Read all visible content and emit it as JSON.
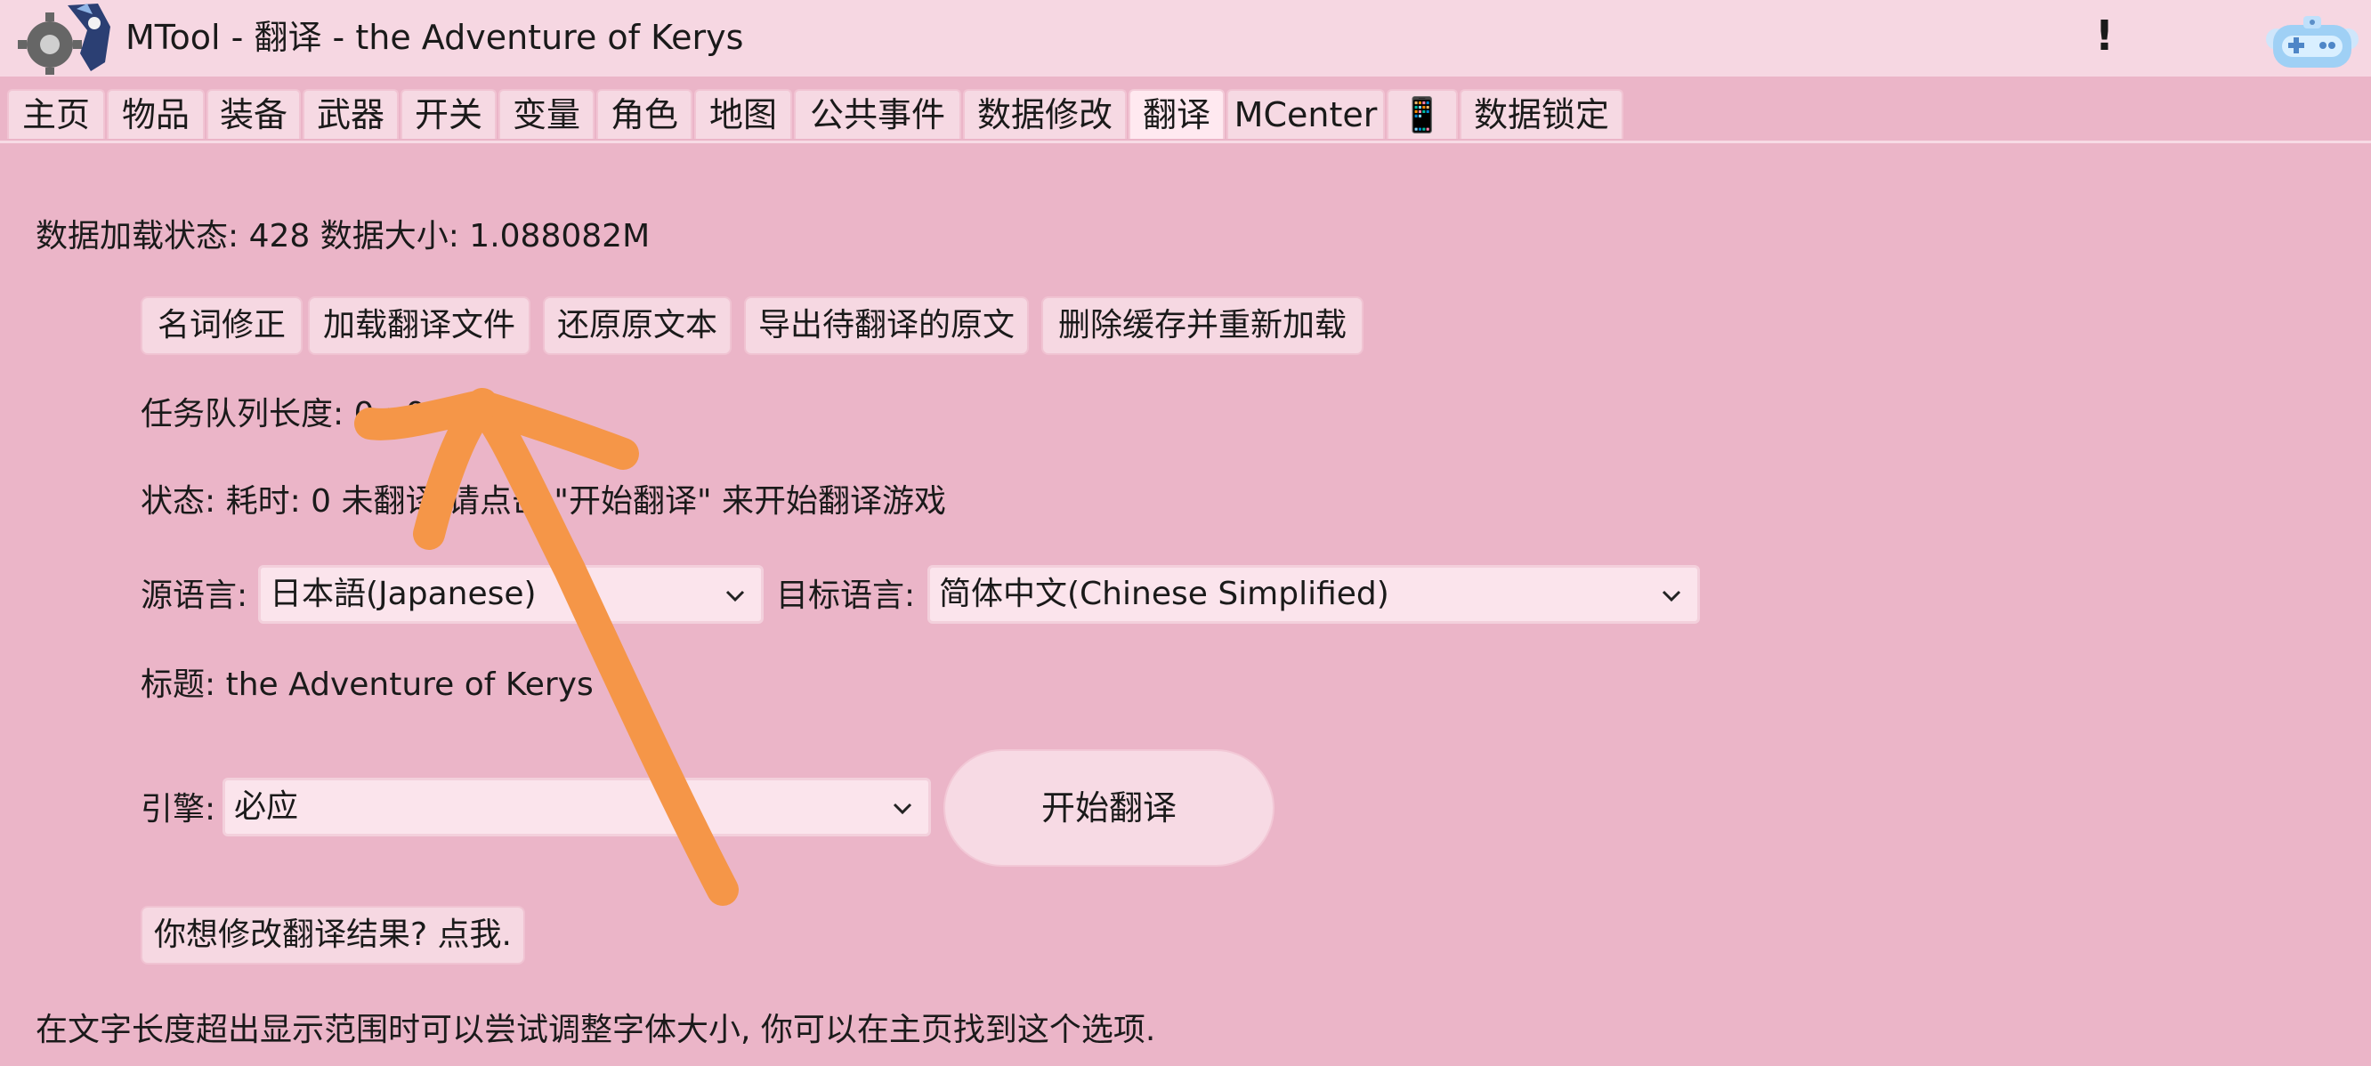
{
  "window": {
    "title": "MTool - 翻译 - the Adventure of Kerys",
    "warning_glyph": "!"
  },
  "icons": {
    "app": "gear-character-icon",
    "gamepad": "gamepad-icon",
    "dropdown": "chevron-down-icon",
    "annotation": "arrow-annotation"
  },
  "tabs": [
    {
      "label": "主页"
    },
    {
      "label": "物品"
    },
    {
      "label": "装备"
    },
    {
      "label": "武器"
    },
    {
      "label": "开关"
    },
    {
      "label": "变量"
    },
    {
      "label": "角色"
    },
    {
      "label": "地图"
    },
    {
      "label": "公共事件"
    },
    {
      "label": "数据修改"
    },
    {
      "label": "翻译",
      "active": true
    },
    {
      "label": "MCenter"
    },
    {
      "label": "📱"
    },
    {
      "label": "数据锁定"
    }
  ],
  "translate": {
    "load_status": "数据加载状态: 428 数据大小: 1.088082M",
    "buttons": {
      "term_fix": "名词修正",
      "load_file": "加载翻译文件",
      "restore": "还原原文本",
      "export": "导出待翻译的原文",
      "clear_reload": "删除缓存并重新加载"
    },
    "queue_length": "任务队列长度: 0 : 0",
    "status": "状态: 耗时: 0 未翻译 请点击 \"开始翻译\" 来开始翻译游戏",
    "source_lang_label": "源语言:",
    "source_lang_value": "日本語(Japanese)",
    "target_lang_label": "目标语言:",
    "target_lang_value": "简体中文(Chinese Simplified)",
    "title_line": "标题: the Adventure of Kerys",
    "engine_label": "引擎:",
    "engine_value": "必应",
    "start_button": "开始翻译",
    "modify_button": "你想修改翻译结果? 点我.",
    "font_hint": "在文字长度超出显示范围时可以尝试调整字体大小, 你可以在主页找到这个选项."
  },
  "colors": {
    "background": "#ebb5c8",
    "titlebar": "#f6d7e2",
    "tab": "#f6d9e3",
    "button": "#f6d8e2",
    "select": "#fbe4ec",
    "annotation_orange": "#f59648"
  }
}
